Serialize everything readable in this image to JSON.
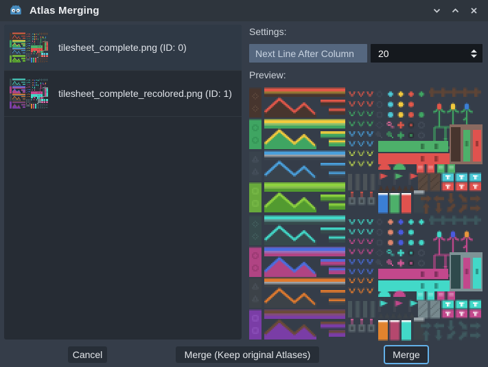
{
  "window": {
    "title": "Atlas Merging"
  },
  "atlas_list": {
    "items": [
      {
        "label": "tilesheet_complete.png (ID: 0)",
        "selected": true
      },
      {
        "label": "tilesheet_complete_recolored.png (ID: 1)",
        "selected": false
      }
    ]
  },
  "settings": {
    "heading": "Settings:",
    "option_label": "Next Line After Column",
    "option_value": "20"
  },
  "preview": {
    "heading": "Preview:"
  },
  "footer": {
    "cancel": "Cancel",
    "merge_keep": "Merge (Keep original Atlases)",
    "merge": "Merge"
  },
  "ui_colors": {
    "titlebar": "#2e353d",
    "body": "#353d49",
    "panel": "#262c34",
    "selected_item": "#2f3945",
    "option_button": "#55677f",
    "spinbox_bg": "#15191e",
    "button_bg": "#272e37",
    "focus_border": "#63b1ea",
    "godot_blue": "#478cbf",
    "text": "#dfe3e9"
  },
  "preview_palettes": {
    "original": {
      "rows": [
        {
          "side": "#47352e",
          "icon": "#5f4a3e",
          "top": "#e25749",
          "body": "#47352e",
          "accent": "#f2c13c"
        },
        {
          "side": "#3fa562",
          "icon": "#2f8b50",
          "top": "#f2ca3d",
          "body": "#3fa562",
          "accent": "#f8e176"
        },
        {
          "side": "#39434d",
          "icon": "#4b5662",
          "top": "#4aa0dc",
          "body": "#39434d",
          "accent": "#ffffff"
        },
        {
          "side": "#68a93c",
          "icon": "#7fc04c",
          "top": "#8ed23f",
          "body": "#529a30",
          "accent": "#c6e86f"
        }
      ],
      "decor": [
        "#e25749",
        "#3fa562",
        "#4aa0dc",
        "#b8d14e"
      ],
      "outline": "#454e5a",
      "gems": [
        "#4cc9d6",
        "#f2ca3d",
        "#e25749"
      ],
      "gem4": "#3fa562",
      "miscA": "#e06a9a",
      "miscB": "#3fa562",
      "fence": "#5d4436",
      "stem": "#3fa562",
      "buds": [
        "#e25749",
        "#f2ca3d",
        "#3b7fd4"
      ],
      "barA": "#4db06a",
      "barB": "#e0524e",
      "blockTan": "#8a6a60",
      "doorDark": "#47352e",
      "panel": "#5a4a40",
      "cards": [
        "#4cc9d6",
        "#e0524e"
      ],
      "liquids": [
        "#3b7fd4",
        "#4db06a",
        "#e0524e"
      ],
      "spike": "#47352e",
      "arrow": "#5d4436",
      "postBar": "#4c5358",
      "postAcc": "#e25749",
      "lantern": "#5b666d",
      "capBlock": "#3a444c",
      "cap": "#98a2a8"
    },
    "recolored": {
      "rows": [
        {
          "side": "#364a4c",
          "icon": "#44605f",
          "top": "#42d9c8",
          "body": "#364a4c",
          "accent": "#8ceadd"
        },
        {
          "side": "#b04483",
          "icon": "#8f3569",
          "top": "#4a6ee0",
          "body": "#b04483",
          "accent": "#7e9cf2"
        },
        {
          "side": "#3c4248",
          "icon": "#4e565e",
          "top": "#e07a2e",
          "body": "#3c4248",
          "accent": "#ffffff"
        },
        {
          "side": "#7a3da6",
          "icon": "#9257c0",
          "top": "#6b4a39",
          "body": "#7a3da6",
          "accent": "#8a5f47"
        }
      ],
      "decor": [
        "#42d9c8",
        "#c2488c",
        "#4a6ee0",
        "#e07a2e"
      ],
      "outline": "#454e5a",
      "gems": [
        "#e0876e",
        "#4a5ae0",
        "#42d9c8"
      ],
      "gem4": "#42d9c8",
      "miscA": "#3fc9b8",
      "miscB": "#d65a9a",
      "fence": "#3c565c",
      "stem": "#c2488c",
      "buds": [
        "#42d9c8",
        "#4a5ae0",
        "#e8953c"
      ],
      "barA": "#c2488c",
      "barB": "#42d9c8",
      "blockTan": "#7e9396",
      "doorDark": "#2f4a4c",
      "panel": "#77898e",
      "cards": [
        "#42d9c8",
        "#c2488c"
      ],
      "liquids": [
        "#e0832e",
        "#b5486e",
        "#42d9c8"
      ],
      "spike": "#3c4248",
      "arrow": "#3e585e",
      "postBar": "#49565c",
      "postAcc": "#e060a0",
      "lantern": "#5b666d",
      "capBlock": "#3c4248",
      "cap": "#9aa5aa"
    }
  }
}
